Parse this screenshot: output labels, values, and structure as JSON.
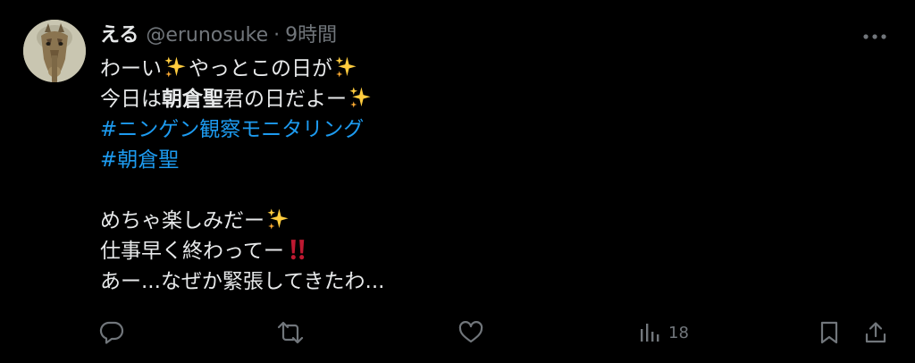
{
  "tweet": {
    "display_name": "える",
    "handle": "@erunosuke",
    "separator": "·",
    "time": "9時間",
    "body": {
      "line1_a": "わーい",
      "line1_b": "やっとこの日が",
      "line2_a": "今日は",
      "line2_bold": "朝倉聖",
      "line2_b": "君の日だよー",
      "hashtag1": "#ニンゲン観察モニタリング",
      "hashtag2": "#朝倉聖",
      "line5": "めちゃ楽しみだー",
      "line6": "仕事早く終わってー",
      "line7": "あー...なぜか緊張してきたわ..."
    },
    "emojis": {
      "sparkles": "sparkles-icon",
      "double_exclamation": "double-exclamation-icon"
    },
    "actions": {
      "views_count": "18"
    }
  },
  "colors": {
    "background": "#000000",
    "text": "#e7e9ea",
    "secondary_text": "#71767b",
    "link": "#1d9bf0",
    "emoji_gold": "#ffcc3e",
    "emoji_red": "#be1931"
  }
}
